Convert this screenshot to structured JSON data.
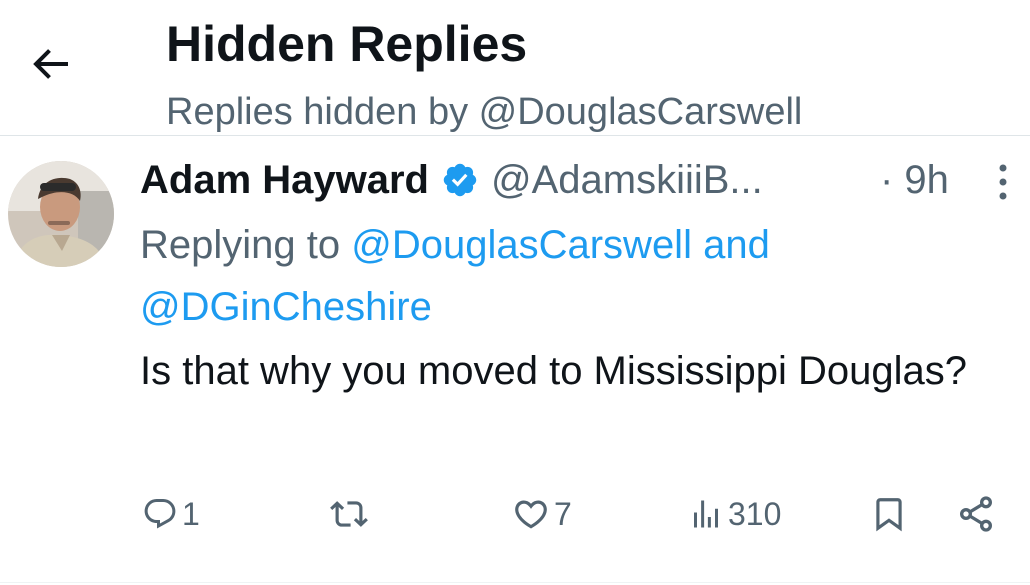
{
  "header": {
    "title": "Hidden Replies",
    "subtitle": "Replies hidden by @DouglasCarswell"
  },
  "tweet": {
    "author_name": "Adam Hayward",
    "author_handle": "@AdamskiiiB...",
    "time": "· 9h",
    "replying_prefix": "Replying to ",
    "mention_1": "@DouglasCarswell",
    "and_word": " and",
    "mention_2": "@DGinCheshire",
    "text": "Is that why you moved to Mississippi Douglas?",
    "verified": true
  },
  "actions": {
    "replies": "1",
    "likes": "7",
    "views": "310"
  },
  "icons": {
    "back": "arrow-left-icon",
    "verified": "verified-badge-icon",
    "more": "more-vertical-icon",
    "reply": "reply-icon",
    "retweet": "retweet-icon",
    "like": "heart-icon",
    "views": "views-icon",
    "bookmark": "bookmark-icon",
    "share": "share-icon"
  },
  "colors": {
    "accent": "#1d9bf0",
    "secondary_text": "#536471",
    "primary_text": "#0f1419"
  }
}
